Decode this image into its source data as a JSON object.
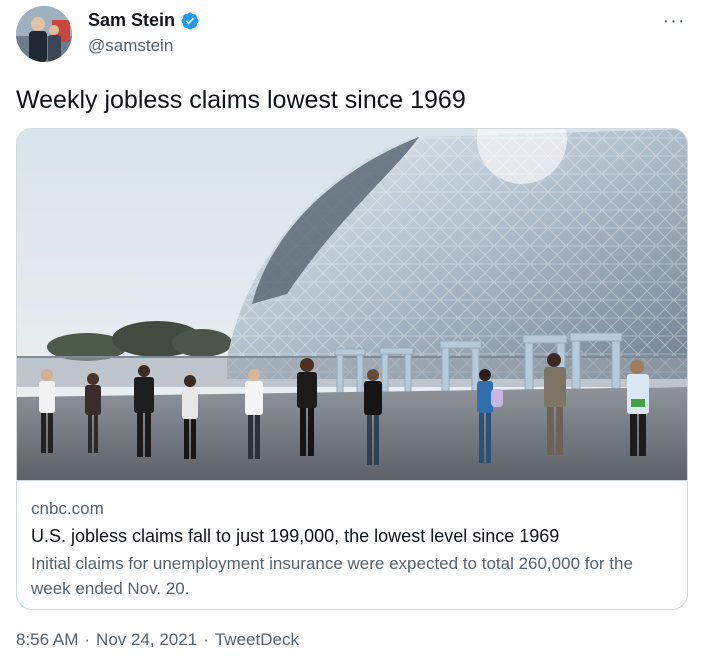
{
  "author": {
    "display_name": "Sam Stein",
    "handle": "@samstein",
    "verified": true
  },
  "tweet": {
    "text": "Weekly jobless claims lowest since 1969",
    "more_label": "···"
  },
  "card": {
    "domain": "cnbc.com",
    "title": "U.S. jobless claims fall to just 199,000, the lowest level since 1969",
    "description": "Initial claims for unemployment insurance were expected to total 260,000 for the week ended Nov. 20.",
    "image_subject": "people waiting in line outside a large glass-lattice stadium"
  },
  "meta": {
    "time": "8:56 AM",
    "separator_1": "·",
    "date": "Nov 24, 2021",
    "separator_2": "·",
    "source": "TweetDeck"
  },
  "colors": {
    "text_primary": "#0f1419",
    "text_secondary": "#536471",
    "border": "#cfd9de",
    "verified_blue": "#1d9bf0"
  },
  "icons": [
    "verified-badge-icon",
    "more-options-icon"
  ]
}
